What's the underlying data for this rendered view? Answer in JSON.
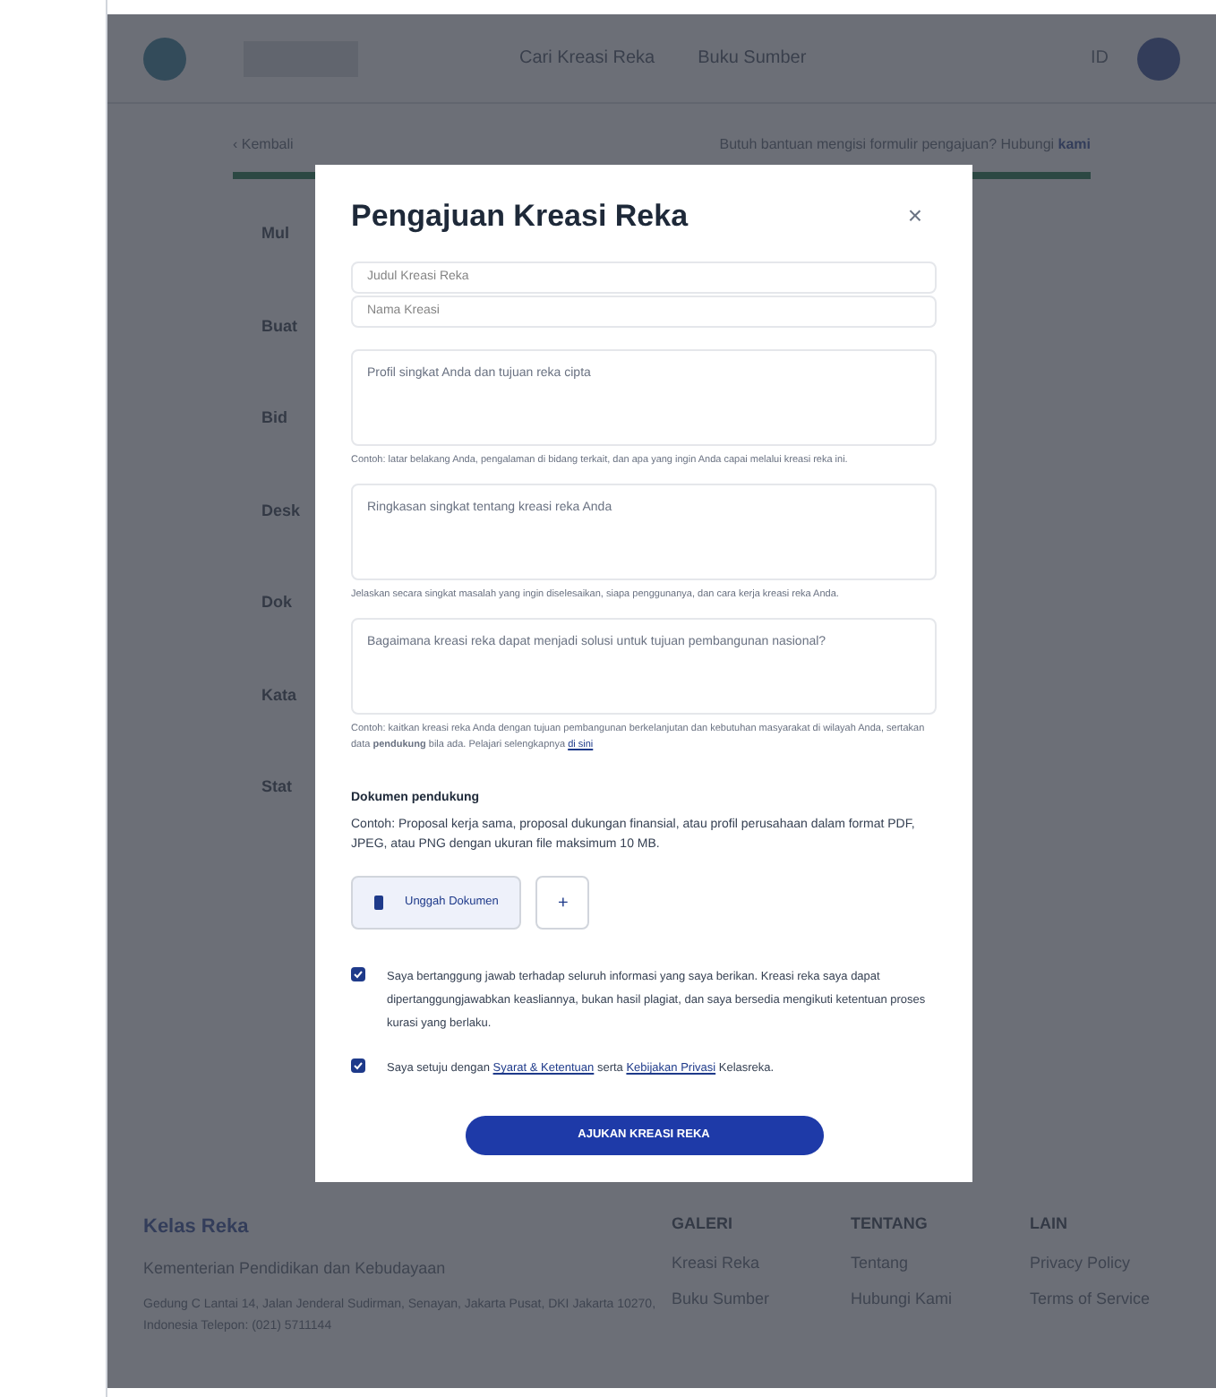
{
  "nav": {
    "links": [
      "Cari Kreasi Reka",
      "Buku Sumber"
    ],
    "language": "ID"
  },
  "back_link": "‹ Kembali",
  "notice": {
    "text": "Butuh bantuan mengisi formulir pengajuan? Hubungi",
    "link": "kami"
  },
  "background_labels": [
    "Mul",
    "Buat",
    "Bid",
    "Desk",
    "Dok",
    "Kata",
    "Stat"
  ],
  "modal": {
    "title": "Pengajuan Kreasi Reka",
    "close": "×",
    "fields": [
      {
        "kind": "input",
        "placeholder": "Judul Kreasi Reka"
      },
      {
        "kind": "input",
        "placeholder": "Nama Kreasi"
      },
      {
        "kind": "textarea",
        "placeholder": "Profil singkat Anda dan tujuan reka cipta",
        "hint": "Contoh: latar belakang Anda, pengalaman di bidang terkait, dan apa yang ingin Anda capai melalui kreasi reka ini."
      },
      {
        "kind": "textarea",
        "placeholder": "Ringkasan singkat tentang kreasi reka Anda",
        "hint": "Jelaskan secara singkat masalah yang ingin diselesaikan, siapa penggunanya, dan cara kerja kreasi reka Anda."
      },
      {
        "kind": "textarea",
        "placeholder": "Bagaimana kreasi reka dapat menjadi solusi untuk tujuan pembangunan nasional?",
        "hint": "Contoh: kaitkan kreasi reka Anda dengan tujuan pembangunan berkelanjutan dan kebutuhan masyarakat di wilayah Anda, sertakan data **pendukung** bila ada. Pelajari selengkapnya",
        "hint_link": "di sini"
      }
    ],
    "documents": {
      "title": "Dokumen pendukung",
      "description": "Contoh: Proposal kerja sama, proposal dukungan finansial, atau profil perusahaan dalam format PDF, JPEG, atau PNG dengan ukuran file maksimum 10 MB.",
      "upload": "Unggah Dokumen",
      "add": "+"
    },
    "agreements": [
      {
        "checked": true,
        "parts": [
          {
            "text": "Saya bertanggung jawab terhadap seluruh informasi yang saya berikan. Kreasi reka saya dapat dipertanggungjawabkan keasliannya, bukan hasil plagiat, dan saya bersedia mengikuti ketentuan proses kurasi yang berlaku."
          }
        ]
      },
      {
        "checked": true,
        "parts": [
          {
            "text": "Saya setuju dengan "
          },
          {
            "text": "Syarat & Ketentuan",
            "link": true
          },
          {
            "text": " serta "
          },
          {
            "text": "Kebijakan Privasi",
            "link": true
          },
          {
            "text": " Kelasreka."
          }
        ]
      }
    ],
    "submit": "AJUKAN KREASI REKA"
  },
  "footer": {
    "brand": "Kelas Reka",
    "tagline": "Kementerian Pendidikan dan Kebudayaan",
    "address": [
      "Gedung C Lantai 14, Jalan Jenderal Sudirman,",
      "Senayan, Jakarta Pusat, DKI Jakarta 10270, Indonesia",
      "Telepon: (021) 5711144"
    ],
    "columns": [
      {
        "title": "GALERI",
        "links": [
          "Kreasi Reka",
          "Buku Sumber"
        ]
      },
      {
        "title": "TENTANG",
        "links": [
          "Tentang",
          "Hubungi Kami"
        ]
      },
      {
        "title": "LAIN",
        "links": [
          "Privacy Policy",
          "Terms of Service"
        ]
      }
    ]
  }
}
